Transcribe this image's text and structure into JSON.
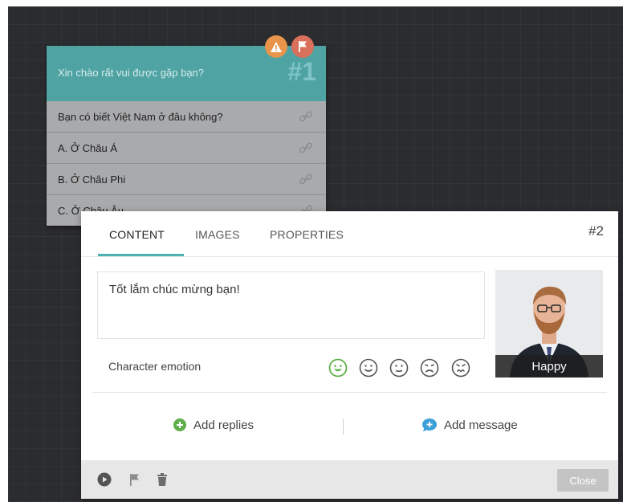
{
  "node": {
    "title": "Xin chào rất vui được gặp bạn?",
    "number": "#1",
    "rows": [
      {
        "label": "Bạn có biết Việt Nam ở đâu không?"
      },
      {
        "label": "A. Ở Châu Á"
      },
      {
        "label": "B. Ở Châu Phi"
      },
      {
        "label": "C. Ở Châu Âu."
      }
    ],
    "badge_warn_icon": "warning-icon",
    "badge_flag_icon": "flag-icon",
    "colors": {
      "header": "#4fa3a3",
      "body": "#a9aaac"
    }
  },
  "panel": {
    "number": "#2",
    "tabs": [
      {
        "label": "CONTENT",
        "active": true
      },
      {
        "label": "IMAGES",
        "active": false
      },
      {
        "label": "PROPERTIES",
        "active": false
      }
    ],
    "message": "Tốt lắm chúc mừng bạn!",
    "emotion_label": "Character emotion",
    "emotions": [
      "happy",
      "smile",
      "neutral",
      "sad",
      "angry"
    ],
    "selected_emotion": "happy",
    "avatar_caption": "Happy",
    "add_replies": "Add replies",
    "add_message": "Add message",
    "close": "Close",
    "accent": "#4fb1b1"
  }
}
